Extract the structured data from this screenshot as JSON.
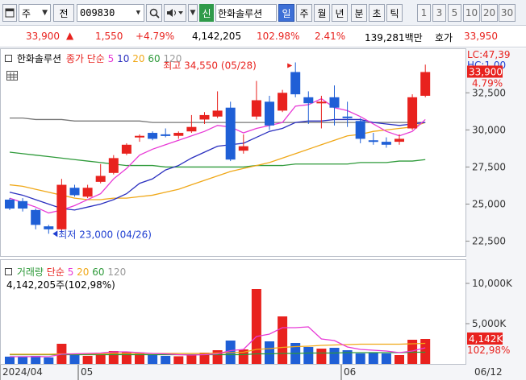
{
  "toolbar": {
    "market": "주",
    "market_type": "전",
    "code": "009830",
    "credit_badge": "신",
    "stock_name": "한화솔루션",
    "periods": [
      "일",
      "주",
      "월",
      "년",
      "분",
      "초",
      "틱"
    ],
    "active_period": "일",
    "intervals": [
      "1",
      "3",
      "5",
      "10",
      "20",
      "30"
    ]
  },
  "quote": {
    "price": "33,900",
    "change": "1,550",
    "change_pct": "+4.79%",
    "volume": "4,142,205",
    "volume_ratio": "102.98%",
    "turnover": "2.41%",
    "amount": "139,281백만",
    "ask_label": "호가",
    "ask_price": "33,950"
  },
  "price_panel": {
    "title": "한화솔루션",
    "ma_label": "종가 단순",
    "ma_periods": [
      "5",
      "10",
      "20",
      "60",
      "120"
    ],
    "high_annotation": "최고 34,550 (05/28)",
    "low_annotation": "최저 23,000 (04/26)",
    "lc_label": "LC:47,39",
    "hc_label": "HC:1,00",
    "price_tag": "33,900",
    "pct_tag": "4.79%"
  },
  "volume_panel": {
    "title": "거래량",
    "ma_label": "단순",
    "ma_periods": [
      "5",
      "20",
      "60",
      "120"
    ],
    "info": "4,142,205주(102,98%)",
    "vol_tag": "4,142K",
    "pct_tag": "102,98%"
  },
  "date_axis": {
    "labels": [
      "2024/04",
      "05",
      "06"
    ],
    "last_date": "06/12"
  },
  "colors": {
    "up": "#e8221e",
    "down": "#1f5fd6",
    "ma5": "#e83ad6",
    "ma10": "#2a2fbf",
    "ma20": "#f0a818",
    "ma60": "#2e9a3a",
    "ma120": "#777777"
  },
  "chart_data": {
    "type": "candlestick",
    "price_axis": {
      "ticks": [
        22500,
        25000,
        27500,
        30000,
        32500
      ],
      "ylim": [
        21500,
        35500
      ]
    },
    "candles": [
      {
        "o": 25300,
        "h": 25400,
        "l": 24600,
        "c": 24700
      },
      {
        "o": 25200,
        "h": 25400,
        "l": 24500,
        "c": 24700
      },
      {
        "o": 24600,
        "h": 24700,
        "l": 23300,
        "c": 23600
      },
      {
        "o": 23500,
        "h": 23600,
        "l": 23000,
        "c": 23300
      },
      {
        "o": 23300,
        "h": 26700,
        "l": 23200,
        "c": 26300
      },
      {
        "o": 26100,
        "h": 26300,
        "l": 25500,
        "c": 25600
      },
      {
        "o": 25500,
        "h": 26300,
        "l": 25400,
        "c": 26100
      },
      {
        "o": 26500,
        "h": 27700,
        "l": 26400,
        "c": 26900
      },
      {
        "o": 27100,
        "h": 28300,
        "l": 27000,
        "c": 28100
      },
      {
        "o": 28400,
        "h": 29100,
        "l": 28300,
        "c": 29000
      },
      {
        "o": 29500,
        "h": 29700,
        "l": 29200,
        "c": 29600
      },
      {
        "o": 29800,
        "h": 29900,
        "l": 29300,
        "c": 29400
      },
      {
        "o": 29700,
        "h": 30100,
        "l": 29500,
        "c": 29600
      },
      {
        "o": 29600,
        "h": 29900,
        "l": 29400,
        "c": 29800
      },
      {
        "o": 29900,
        "h": 31000,
        "l": 29800,
        "c": 30200
      },
      {
        "o": 30700,
        "h": 31200,
        "l": 30400,
        "c": 31000
      },
      {
        "o": 30900,
        "h": 32600,
        "l": 30800,
        "c": 31300
      },
      {
        "o": 31500,
        "h": 31900,
        "l": 27900,
        "c": 28000
      },
      {
        "o": 28600,
        "h": 29700,
        "l": 28400,
        "c": 28900
      },
      {
        "o": 30900,
        "h": 33300,
        "l": 30700,
        "c": 32000
      },
      {
        "o": 31900,
        "h": 32300,
        "l": 30000,
        "c": 30300
      },
      {
        "o": 31300,
        "h": 32700,
        "l": 31200,
        "c": 32500
      },
      {
        "o": 33900,
        "h": 34550,
        "l": 32200,
        "c": 32400
      },
      {
        "o": 32200,
        "h": 32600,
        "l": 30400,
        "c": 31800
      },
      {
        "o": 31900,
        "h": 32300,
        "l": 30100,
        "c": 31900
      },
      {
        "o": 32200,
        "h": 33000,
        "l": 30300,
        "c": 31500
      },
      {
        "o": 30900,
        "h": 31900,
        "l": 30200,
        "c": 30800
      },
      {
        "o": 30600,
        "h": 30800,
        "l": 29100,
        "c": 29400
      },
      {
        "o": 29300,
        "h": 29800,
        "l": 29000,
        "c": 29200
      },
      {
        "o": 29200,
        "h": 29500,
        "l": 28800,
        "c": 29000
      },
      {
        "o": 29200,
        "h": 29700,
        "l": 29000,
        "c": 29400
      },
      {
        "o": 30100,
        "h": 32400,
        "l": 30000,
        "c": 32200
      },
      {
        "o": 32300,
        "h": 34400,
        "l": 32200,
        "c": 33900
      }
    ],
    "ma5": [
      25400,
      25100,
      24800,
      24400,
      24600,
      24900,
      25300,
      25700,
      26700,
      27400,
      28300,
      28700,
      29000,
      29300,
      29600,
      29900,
      30300,
      30200,
      29800,
      30100,
      30300,
      30500,
      31600,
      31700,
      32100,
      31500,
      31300,
      30900,
      30400,
      29900,
      29600,
      29900,
      30700
    ],
    "ma10": [
      25800,
      25600,
      25300,
      25000,
      24700,
      24600,
      24800,
      25000,
      25300,
      25700,
      26400,
      26700,
      27300,
      27600,
      28100,
      28500,
      28900,
      29000,
      29100,
      29500,
      29900,
      30100,
      30500,
      30600,
      30600,
      30700,
      30700,
      30700,
      30500,
      30400,
      30300,
      30400,
      30500
    ],
    "ma20": [
      26300,
      26200,
      26000,
      25800,
      25600,
      25400,
      25300,
      25300,
      25400,
      25400,
      25500,
      25600,
      25800,
      26000,
      26300,
      26600,
      26900,
      27200,
      27400,
      27600,
      27800,
      28100,
      28400,
      28700,
      29000,
      29300,
      29600,
      29700,
      29900,
      30000,
      30100,
      30200,
      30500
    ],
    "ma60": [
      28500,
      28400,
      28300,
      28200,
      28100,
      28000,
      27900,
      27800,
      27700,
      27600,
      27600,
      27600,
      27500,
      27500,
      27500,
      27500,
      27500,
      27500,
      27500,
      27600,
      27600,
      27600,
      27700,
      27700,
      27700,
      27700,
      27700,
      27800,
      27800,
      27800,
      27900,
      27900,
      28000
    ],
    "ma120": [
      30800,
      30800,
      30700,
      30700,
      30700,
      30600,
      30600,
      30600,
      30600,
      30600,
      30600,
      30500,
      30500,
      30500,
      30500,
      30500,
      30500,
      30500,
      30500,
      30500,
      30500,
      30500,
      30500,
      30500,
      30500,
      30500,
      30500,
      30500,
      30500,
      30500,
      30500,
      30500,
      30500
    ],
    "volume_axis": {
      "ticks": [
        5000000,
        10000000
      ],
      "tick_labels": [
        "5,000K",
        "10,000K"
      ],
      "ylim": [
        0,
        13000000
      ]
    },
    "volume": [
      900000,
      850000,
      1000000,
      800000,
      2500000,
      1100000,
      1000000,
      1400000,
      1600000,
      1500000,
      1300000,
      1100000,
      1000000,
      950000,
      1200000,
      1400000,
      1700000,
      2900000,
      1800000,
      9300000,
      2800000,
      5900000,
      2600000,
      2100000,
      1900000,
      2000000,
      1700000,
      1300000,
      1400000,
      1300000,
      1100000,
      3000000,
      3100000
    ],
    "vol_ma5": [
      900000,
      900000,
      920000,
      900000,
      1200000,
      1250000,
      1300000,
      1350000,
      1500000,
      1500000,
      1400000,
      1300000,
      1250000,
      1150000,
      1100000,
      1150000,
      1250000,
      1650000,
      1800000,
      3400000,
      3700000,
      4500000,
      4500000,
      4600000,
      3100000,
      2900000,
      2100000,
      1800000,
      1700000,
      1600000,
      1400000,
      1600000,
      2000000
    ],
    "vol_ma20": [
      1200000,
      1200000,
      1200000,
      1200000,
      1250000,
      1250000,
      1250000,
      1250000,
      1300000,
      1300000,
      1300000,
      1300000,
      1300000,
      1300000,
      1300000,
      1300000,
      1350000,
      1400000,
      1450000,
      1800000,
      1900000,
      2050000,
      2150000,
      2200000,
      2300000,
      2350000,
      2400000,
      2450000,
      2450000,
      2450000,
      2450000,
      2500000,
      2550000
    ],
    "vol_ma60": [
      1150000,
      1150000,
      1150000,
      1150000,
      1150000,
      1150000,
      1150000,
      1150000,
      1150000,
      1150000,
      1150000,
      1150000,
      1150000,
      1150000,
      1150000,
      1150000,
      1150000,
      1150000,
      1150000,
      1250000,
      1250000,
      1300000,
      1300000,
      1350000,
      1350000,
      1350000,
      1400000,
      1400000,
      1400000,
      1400000,
      1400000,
      1450000,
      1450000
    ]
  }
}
